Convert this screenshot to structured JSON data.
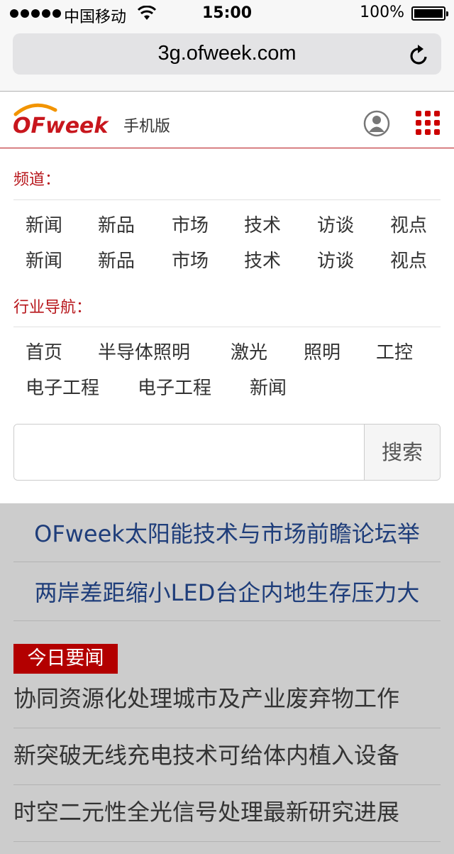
{
  "status_bar": {
    "carrier": "中国移动",
    "time": "15:00",
    "battery": "100%",
    "battery_level": 1.0
  },
  "browser": {
    "url": "3g.ofweek.com"
  },
  "header": {
    "logo_text": "OFweek",
    "logo_sub": "手机版"
  },
  "channels": {
    "label": "频道：",
    "rows": [
      [
        "新闻",
        "新品",
        "市场",
        "技术",
        "访谈",
        "视点"
      ],
      [
        "新闻",
        "新品",
        "市场",
        "技术",
        "访谈",
        "视点"
      ]
    ]
  },
  "industry_nav": {
    "label": "行业导航：",
    "row1": [
      "首页",
      "半导体照明",
      "激光",
      "照明",
      "工控"
    ],
    "row2": [
      "电子工程",
      "电子工程",
      "新闻"
    ]
  },
  "search": {
    "placeholder": "",
    "button_label": "搜索"
  },
  "headlines": [
    "OFweek太阳能技术与市场前瞻论坛举",
    "两岸差距缩小LED台企内地生存压力大"
  ],
  "today": {
    "badge": "今日要闻",
    "items": [
      "协同资源化处理城市及产业废弃物工作",
      "新突破无线充电技术可给体内植入设备",
      "时空二元性全光信号处理最新研究进展"
    ]
  },
  "colors": {
    "brand_red": "#b7151a",
    "headline_blue": "#1e3d7a",
    "badge_red": "#b30000"
  }
}
